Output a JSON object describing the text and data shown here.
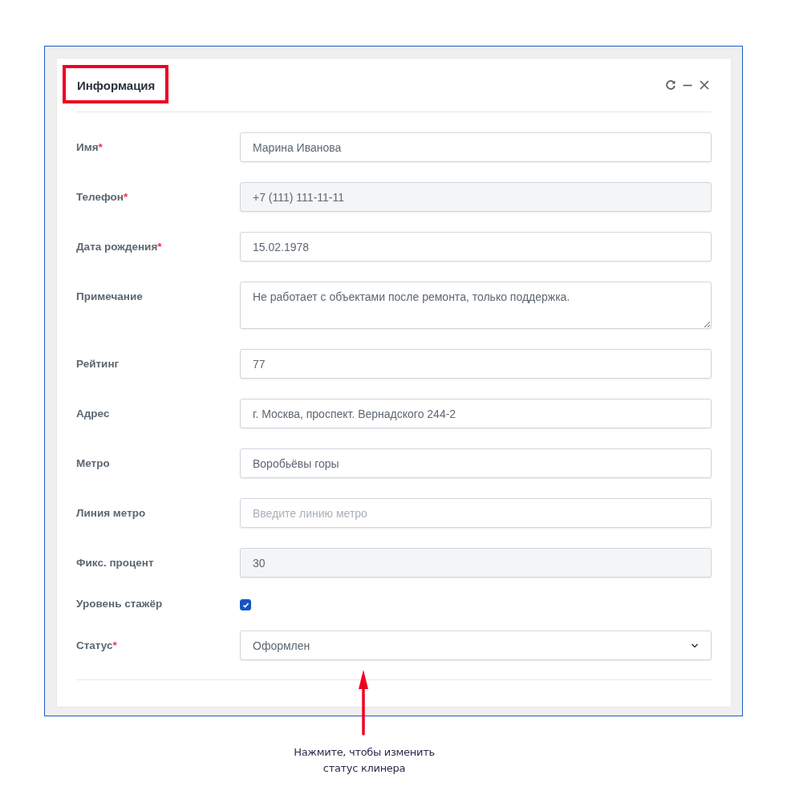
{
  "panel": {
    "title": "Информация",
    "actions": [
      {
        "kind": "refresh"
      },
      {
        "kind": "minimize"
      },
      {
        "kind": "close"
      }
    ]
  },
  "fields": [
    {
      "kind": "text",
      "label": "Имя",
      "required_mark": "*",
      "disabled": false,
      "value": "Марина Иванова"
    },
    {
      "kind": "text",
      "label": "Телефон",
      "required_mark": "*",
      "disabled": true,
      "value": "+7 (111) 111-11-11"
    },
    {
      "kind": "text",
      "label": "Дата рождения",
      "required_mark": "*",
      "disabled": false,
      "value": "15.02.1978"
    },
    {
      "kind": "textarea",
      "label": "Примечание",
      "disabled": false,
      "value": "Не работает с объектами после ремонта, только поддержка."
    },
    {
      "kind": "text",
      "label": "Рейтинг",
      "disabled": false,
      "value": "77"
    },
    {
      "kind": "text",
      "label": "Адрес",
      "disabled": false,
      "value": "г. Москва, проспект. Вернадского 244-2"
    },
    {
      "kind": "text",
      "label": "Метро",
      "disabled": false,
      "value": "Воробьёвы горы"
    },
    {
      "kind": "text",
      "label": "Линия метро",
      "disabled": false,
      "placeholder": "Введите линию метро"
    },
    {
      "kind": "text",
      "label": "Фикс. процент",
      "disabled": true,
      "value": "30"
    },
    {
      "kind": "checkbox",
      "label": "Уровень стажёр",
      "checked": true
    },
    {
      "kind": "select",
      "label": "Статус",
      "required_mark": "*",
      "value": "Оформлен"
    }
  ],
  "annotation": {
    "text_lines": [
      "Нажмите, чтобы изменить",
      "статус клинера"
    ]
  }
}
